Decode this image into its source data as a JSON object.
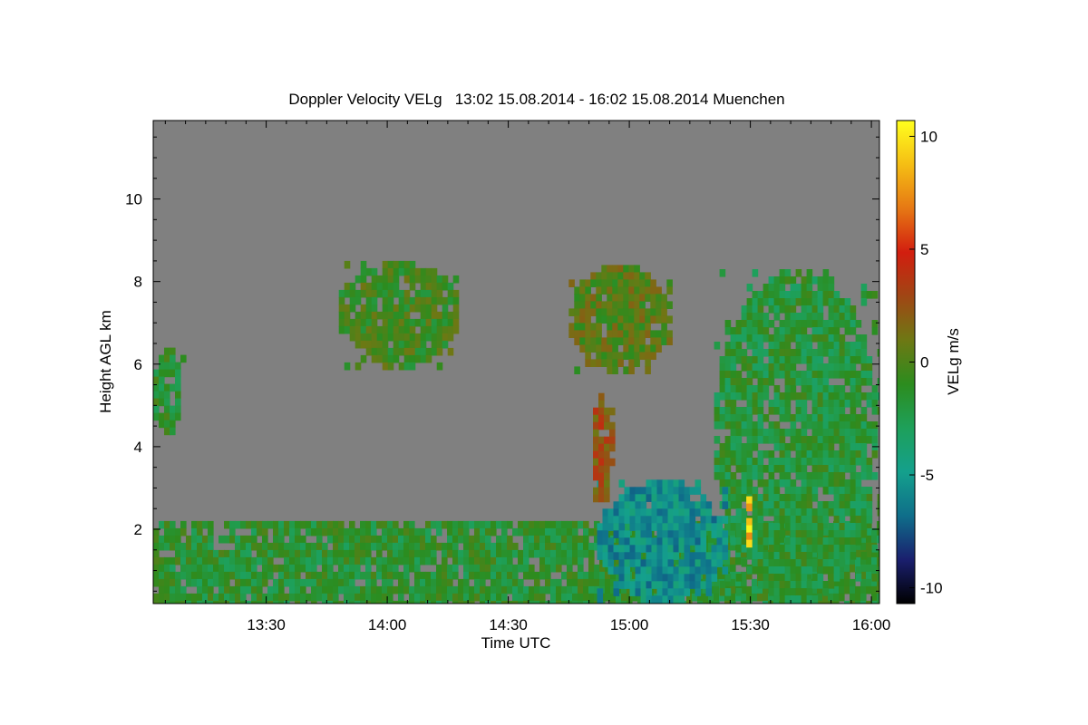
{
  "chart_data": {
    "type": "heatmap",
    "title": "Doppler Velocity VELg   13:02 15.08.2014 - 16:02 15.08.2014 Muenchen",
    "xlabel": "Time UTC",
    "ylabel": "Height AGL km",
    "x_range_minutes_utc": [
      782,
      962
    ],
    "y_range_km": [
      0.2,
      11.9
    ],
    "x_ticks": [
      {
        "minutes": 810,
        "label": "13:30"
      },
      {
        "minutes": 840,
        "label": "14:00"
      },
      {
        "minutes": 870,
        "label": "14:30"
      },
      {
        "minutes": 900,
        "label": "15:00"
      },
      {
        "minutes": 930,
        "label": "15:30"
      },
      {
        "minutes": 960,
        "label": "16:00"
      }
    ],
    "y_ticks": [
      {
        "value": 2,
        "label": "2"
      },
      {
        "value": 4,
        "label": "4"
      },
      {
        "value": 6,
        "label": "6"
      },
      {
        "value": 8,
        "label": "8"
      },
      {
        "value": 10,
        "label": "10"
      }
    ],
    "colorbar": {
      "label": "VELg m/s",
      "range": [
        -10.7,
        10.7
      ],
      "ticks": [
        {
          "value": 10,
          "label": "10"
        },
        {
          "value": 5,
          "label": "5"
        },
        {
          "value": 0,
          "label": "0"
        },
        {
          "value": -5,
          "label": "-5"
        },
        {
          "value": -10,
          "label": "-10"
        }
      ],
      "colors": [
        "#000000",
        "#1a1f6e",
        "#0f6e8a",
        "#14a08c",
        "#1ea05a",
        "#2c8c1e",
        "#6e7814",
        "#a04614",
        "#d21e0f",
        "#e67814",
        "#f5be14",
        "#ffff1e"
      ]
    },
    "background_color": "#808080",
    "echo_regions": [
      {
        "name": "boundary layer",
        "time": [
          782,
          962
        ],
        "height_km": [
          0.2,
          2.2
        ],
        "velocity_ms": -1.5
      },
      {
        "name": "mid-level cloud 1",
        "time": [
          828,
          858
        ],
        "height_km": [
          5.9,
          8.5
        ],
        "velocity_ms": -0.5
      },
      {
        "name": "mid-level cloud 2",
        "time": [
          885,
          910
        ],
        "height_km": [
          5.8,
          8.4
        ],
        "velocity_ms": 0.3
      },
      {
        "name": "cloud left edge",
        "time": [
          782,
          789
        ],
        "height_km": [
          4.3,
          6.4
        ],
        "velocity_ms": -1.5
      },
      {
        "name": "deep cloud",
        "time": [
          921,
          962
        ],
        "height_km": [
          0.2,
          8.3
        ],
        "velocity_ms": -1.8
      },
      {
        "name": "convective downdraft",
        "time": [
          892,
          924
        ],
        "height_km": [
          0.2,
          3.2
        ],
        "velocity_ms": -5.5
      },
      {
        "name": "fall streak",
        "time": [
          891,
          896
        ],
        "height_km": [
          2.8,
          5.3
        ],
        "velocity_ms": 2.5
      },
      {
        "name": "updraft core",
        "time": [
          929,
          930
        ],
        "height_km": [
          1.6,
          2.8
        ],
        "velocity_ms": 9.0
      }
    ]
  }
}
